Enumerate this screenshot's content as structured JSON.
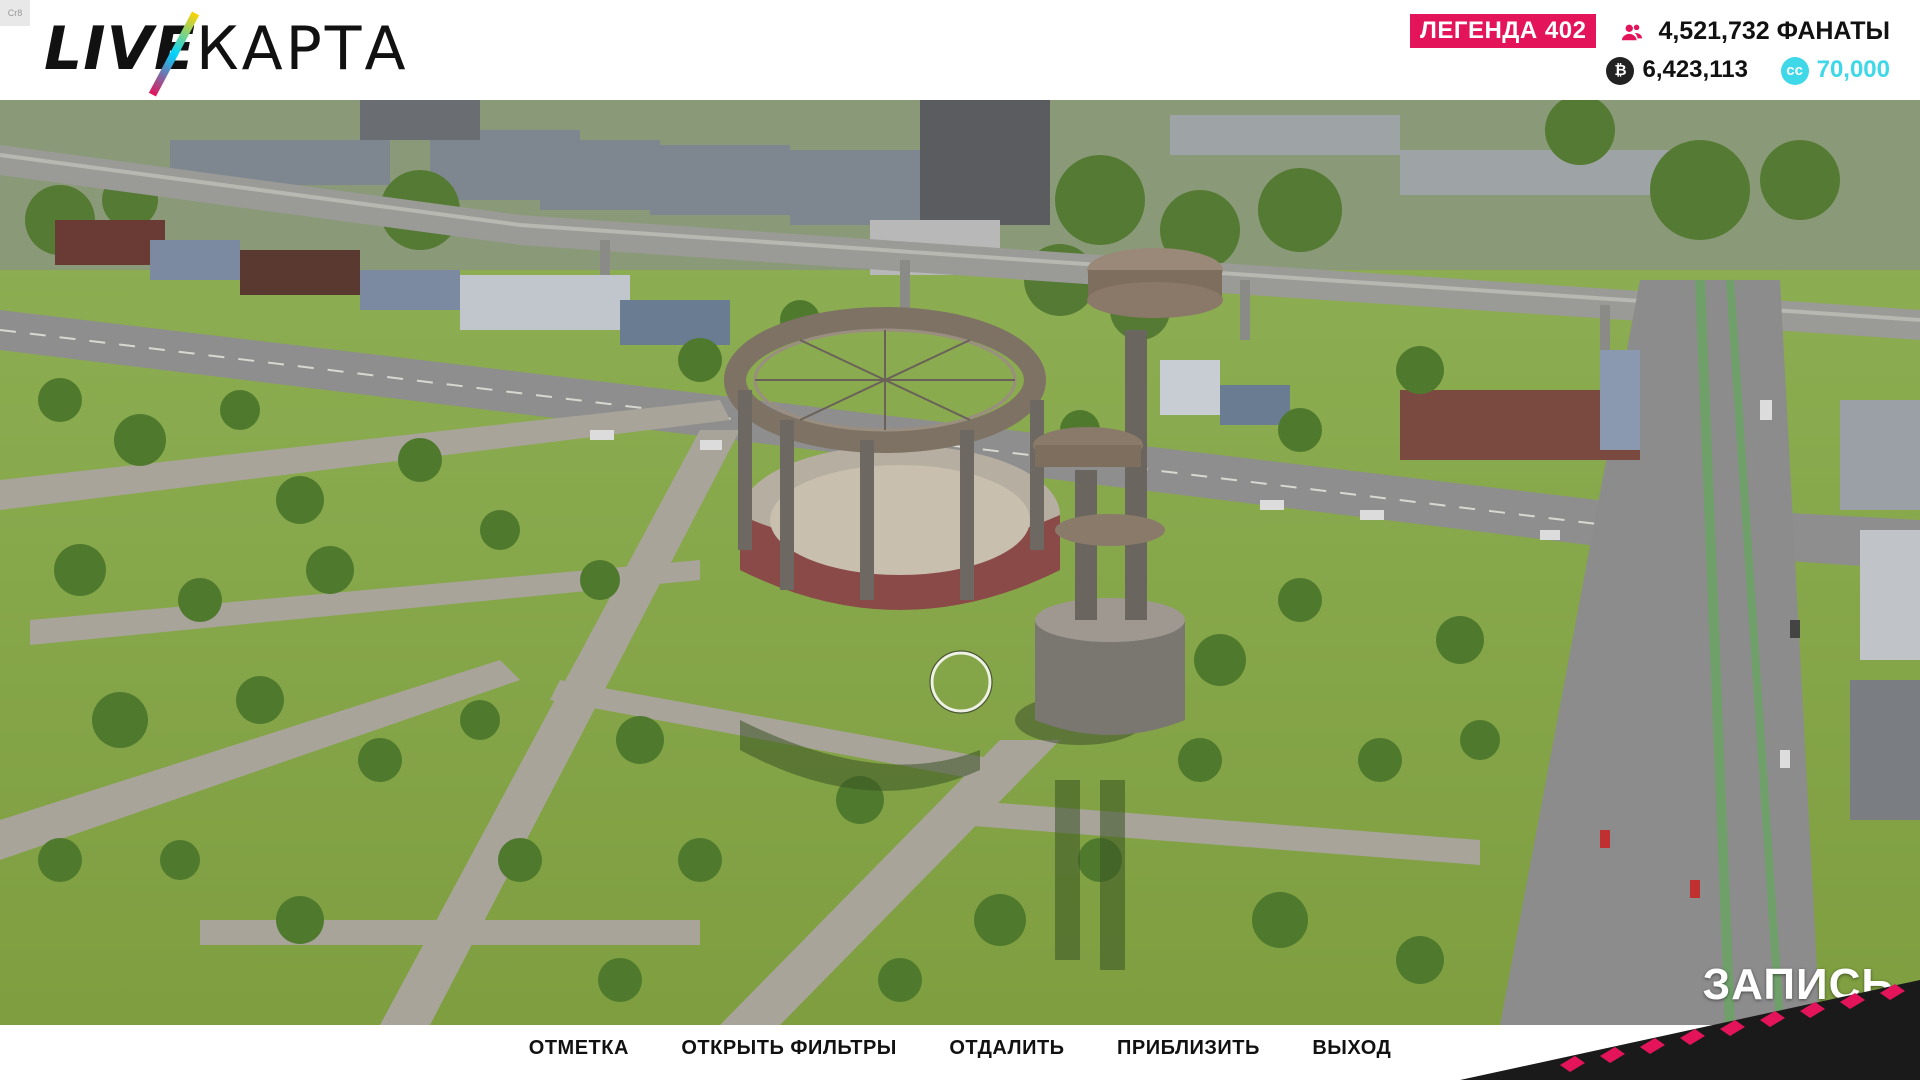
{
  "header": {
    "logo_live": "LIVE",
    "logo_map": "КАРТА",
    "corner_tag": "Cr8",
    "legend_label": "ЛЕГЕНДА 402",
    "fans_count": "4,521,732",
    "fans_label": "ФАНАТЫ",
    "credits": "6,423,113",
    "forza_points": "70,000",
    "credits_coin": "₿",
    "fp_coin": "cc"
  },
  "record_label": "ЗАПИСЬ",
  "footer": {
    "actions": [
      "ОТМЕТКА",
      "ОТКРЫТЬ ФИЛЬТРЫ",
      "ОТДАЛИТЬ",
      "ПРИБЛИЗИТЬ",
      "ВЫХОД"
    ]
  },
  "colors": {
    "accent_pink": "#e4145a",
    "fp_cyan": "#3fd8e8",
    "grass": "#7fa045",
    "road": "#8e8e8e"
  }
}
